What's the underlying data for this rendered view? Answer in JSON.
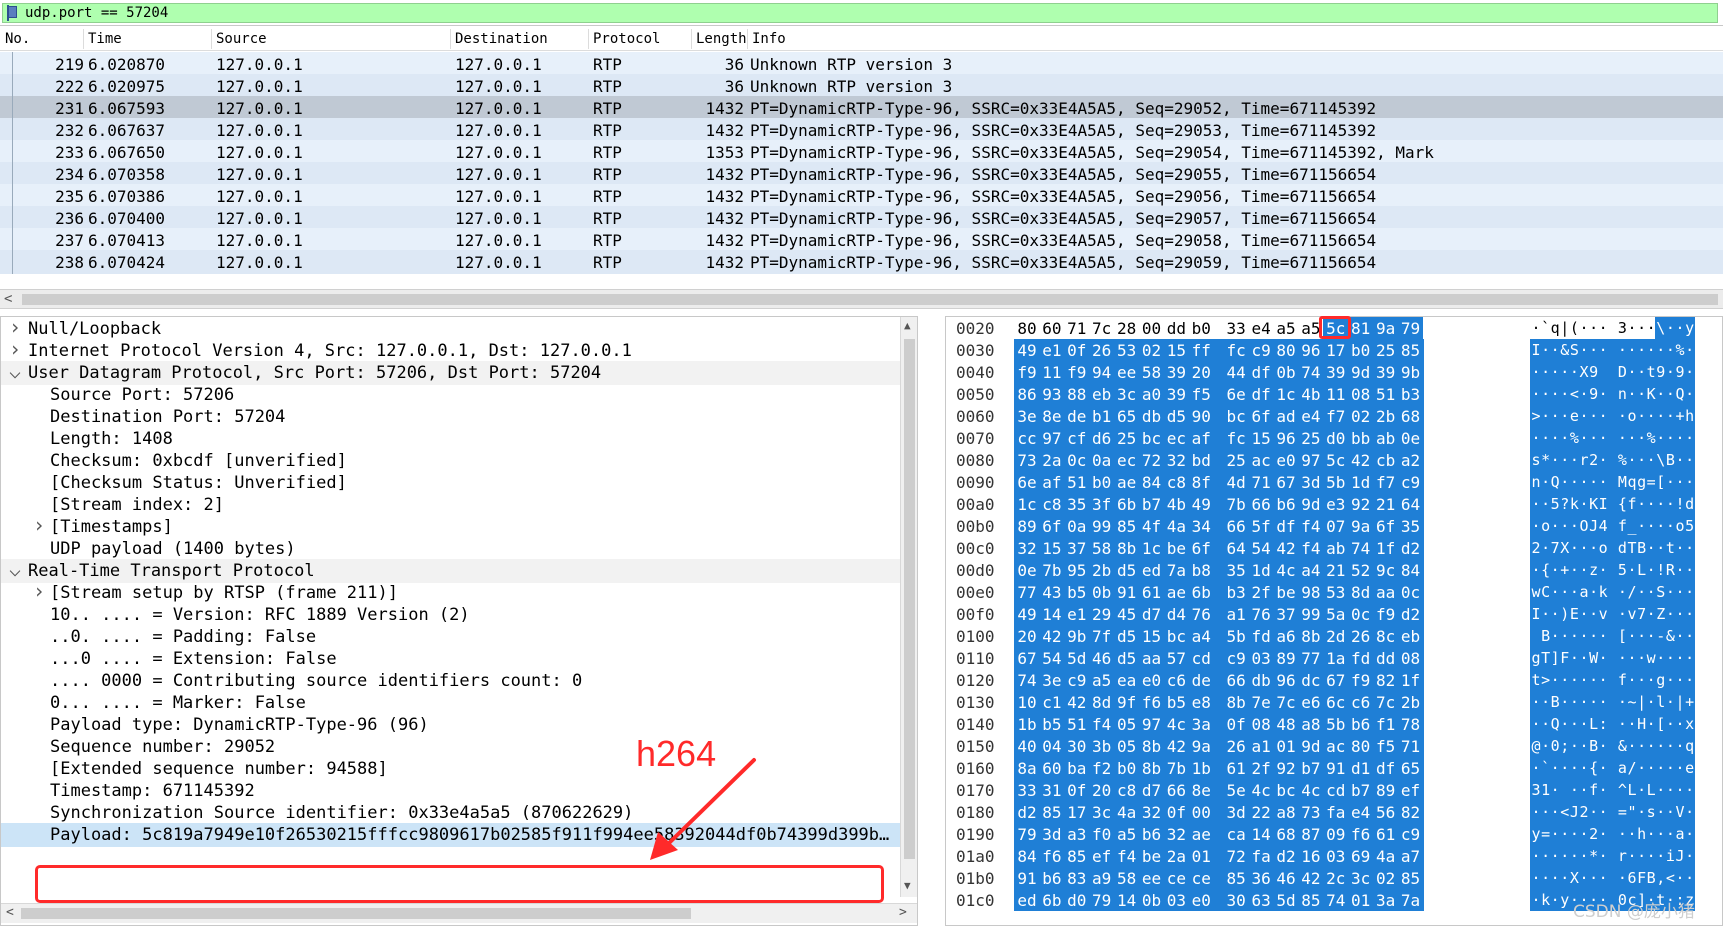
{
  "filter": {
    "text": "udp.port == 57204"
  },
  "packet_list": {
    "columns": [
      "No.",
      "Time",
      "Source",
      "Destination",
      "Protocol",
      "Length",
      "Info"
    ],
    "rows": [
      {
        "no": "219",
        "time": "6.020870",
        "src": "127.0.0.1",
        "dst": "127.0.0.1",
        "proto": "RTP",
        "len": "36",
        "info": "Unknown RTP version 3"
      },
      {
        "no": "222",
        "time": "6.020975",
        "src": "127.0.0.1",
        "dst": "127.0.0.1",
        "proto": "RTP",
        "len": "36",
        "info": "Unknown RTP version 3"
      },
      {
        "no": "231",
        "time": "6.067593",
        "src": "127.0.0.1",
        "dst": "127.0.0.1",
        "proto": "RTP",
        "len": "1432",
        "info": "PT=DynamicRTP-Type-96, SSRC=0x33E4A5A5, Seq=29052, Time=671145392"
      },
      {
        "no": "232",
        "time": "6.067637",
        "src": "127.0.0.1",
        "dst": "127.0.0.1",
        "proto": "RTP",
        "len": "1432",
        "info": "PT=DynamicRTP-Type-96, SSRC=0x33E4A5A5, Seq=29053, Time=671145392"
      },
      {
        "no": "233",
        "time": "6.067650",
        "src": "127.0.0.1",
        "dst": "127.0.0.1",
        "proto": "RTP",
        "len": "1353",
        "info": "PT=DynamicRTP-Type-96, SSRC=0x33E4A5A5, Seq=29054, Time=671145392, Mark"
      },
      {
        "no": "234",
        "time": "6.070358",
        "src": "127.0.0.1",
        "dst": "127.0.0.1",
        "proto": "RTP",
        "len": "1432",
        "info": "PT=DynamicRTP-Type-96, SSRC=0x33E4A5A5, Seq=29055, Time=671156654"
      },
      {
        "no": "235",
        "time": "6.070386",
        "src": "127.0.0.1",
        "dst": "127.0.0.1",
        "proto": "RTP",
        "len": "1432",
        "info": "PT=DynamicRTP-Type-96, SSRC=0x33E4A5A5, Seq=29056, Time=671156654"
      },
      {
        "no": "236",
        "time": "6.070400",
        "src": "127.0.0.1",
        "dst": "127.0.0.1",
        "proto": "RTP",
        "len": "1432",
        "info": "PT=DynamicRTP-Type-96, SSRC=0x33E4A5A5, Seq=29057, Time=671156654"
      },
      {
        "no": "237",
        "time": "6.070413",
        "src": "127.0.0.1",
        "dst": "127.0.0.1",
        "proto": "RTP",
        "len": "1432",
        "info": "PT=DynamicRTP-Type-96, SSRC=0x33E4A5A5, Seq=29058, Time=671156654"
      },
      {
        "no": "238",
        "time": "6.070424",
        "src": "127.0.0.1",
        "dst": "127.0.0.1",
        "proto": "RTP",
        "len": "1432",
        "info": "PT=DynamicRTP-Type-96, SSRC=0x33E4A5A5, Seq=29059, Time=671156654"
      }
    ],
    "selected_index": 2
  },
  "details": [
    {
      "indent": 0,
      "chev": ">",
      "text": "Null/Loopback",
      "section": false
    },
    {
      "indent": 0,
      "chev": ">",
      "text": "Internet Protocol Version 4, Src: 127.0.0.1, Dst: 127.0.0.1",
      "section": false
    },
    {
      "indent": 0,
      "chev": "v",
      "text": "User Datagram Protocol, Src Port: 57206, Dst Port: 57204",
      "section": true
    },
    {
      "indent": 1,
      "chev": "",
      "text": "Source Port: 57206",
      "section": false
    },
    {
      "indent": 1,
      "chev": "",
      "text": "Destination Port: 57204",
      "section": false
    },
    {
      "indent": 1,
      "chev": "",
      "text": "Length: 1408",
      "section": false
    },
    {
      "indent": 1,
      "chev": "",
      "text": "Checksum: 0xbcdf [unverified]",
      "section": false
    },
    {
      "indent": 1,
      "chev": "",
      "text": "[Checksum Status: Unverified]",
      "section": false
    },
    {
      "indent": 1,
      "chev": "",
      "text": "[Stream index: 2]",
      "section": false
    },
    {
      "indent": 1,
      "chev": ">",
      "text": "[Timestamps]",
      "section": false
    },
    {
      "indent": 1,
      "chev": "",
      "text": "UDP payload (1400 bytes)",
      "section": false
    },
    {
      "indent": 0,
      "chev": "v",
      "text": "Real-Time Transport Protocol",
      "section": true
    },
    {
      "indent": 1,
      "chev": ">",
      "text": "[Stream setup by RTSP (frame 211)]",
      "section": false
    },
    {
      "indent": 1,
      "chev": "",
      "text": "10.. .... = Version: RFC 1889 Version (2)",
      "section": false
    },
    {
      "indent": 1,
      "chev": "",
      "text": "..0. .... = Padding: False",
      "section": false
    },
    {
      "indent": 1,
      "chev": "",
      "text": "...0 .... = Extension: False",
      "section": false
    },
    {
      "indent": 1,
      "chev": "",
      "text": ".... 0000 = Contributing source identifiers count: 0",
      "section": false
    },
    {
      "indent": 1,
      "chev": "",
      "text": "0... .... = Marker: False",
      "section": false
    },
    {
      "indent": 1,
      "chev": "",
      "text": "Payload type: DynamicRTP-Type-96 (96)",
      "section": false
    },
    {
      "indent": 1,
      "chev": "",
      "text": "Sequence number: 29052",
      "section": false
    },
    {
      "indent": 1,
      "chev": "",
      "text": "[Extended sequence number: 94588]",
      "section": false
    },
    {
      "indent": 1,
      "chev": "",
      "text": "Timestamp: 671145392",
      "section": false
    },
    {
      "indent": 1,
      "chev": "",
      "text": "Synchronization Source identifier: 0x33e4a5a5 (870622629)",
      "section": false
    },
    {
      "indent": 1,
      "chev": "",
      "text": "Payload: 5c819a7949e10f26530215fffcc9809617b02585f911f994ee58392044df0b74399d399b…",
      "section": false,
      "selected": true
    }
  ],
  "hex": {
    "rows": [
      {
        "off": "0020",
        "bytes": [
          "80",
          "60",
          "71",
          "7c",
          "28",
          "00",
          "dd",
          "b0",
          "33",
          "e4",
          "a5",
          "a5",
          "5c",
          "81",
          "9a",
          "79"
        ],
        "ascii": "·`q|(··· 3···\\··y",
        "hl_start": 12
      },
      {
        "off": "0030",
        "bytes": [
          "49",
          "e1",
          "0f",
          "26",
          "53",
          "02",
          "15",
          "ff",
          "fc",
          "c9",
          "80",
          "96",
          "17",
          "b0",
          "25",
          "85"
        ],
        "ascii": "I··&S··· ······%·",
        "hl_start": 0
      },
      {
        "off": "0040",
        "bytes": [
          "f9",
          "11",
          "f9",
          "94",
          "ee",
          "58",
          "39",
          "20",
          "44",
          "df",
          "0b",
          "74",
          "39",
          "9d",
          "39",
          "9b"
        ],
        "ascii": "·····X9  D··t9·9·",
        "hl_start": 0
      },
      {
        "off": "0050",
        "bytes": [
          "86",
          "93",
          "88",
          "eb",
          "3c",
          "a0",
          "39",
          "f5",
          "6e",
          "df",
          "1c",
          "4b",
          "11",
          "08",
          "51",
          "b3"
        ],
        "ascii": "····<·9· n··K··Q·",
        "hl_start": 0
      },
      {
        "off": "0060",
        "bytes": [
          "3e",
          "8e",
          "de",
          "b1",
          "65",
          "db",
          "d5",
          "90",
          "bc",
          "6f",
          "ad",
          "e4",
          "f7",
          "02",
          "2b",
          "68"
        ],
        "ascii": ">···e··· ·o····+h",
        "hl_start": 0
      },
      {
        "off": "0070",
        "bytes": [
          "cc",
          "97",
          "cf",
          "d6",
          "25",
          "bc",
          "ec",
          "af",
          "fc",
          "15",
          "96",
          "25",
          "d0",
          "bb",
          "ab",
          "0e"
        ],
        "ascii": "····%··· ···%····",
        "hl_start": 0
      },
      {
        "off": "0080",
        "bytes": [
          "73",
          "2a",
          "0c",
          "0a",
          "ec",
          "72",
          "32",
          "bd",
          "25",
          "ac",
          "e0",
          "97",
          "5c",
          "42",
          "cb",
          "a2"
        ],
        "ascii": "s*···r2· %···\\B··",
        "hl_start": 0
      },
      {
        "off": "0090",
        "bytes": [
          "6e",
          "af",
          "51",
          "b0",
          "ae",
          "84",
          "c8",
          "8f",
          "4d",
          "71",
          "67",
          "3d",
          "5b",
          "1d",
          "f7",
          "c9"
        ],
        "ascii": "n·Q····· Mqg=[···",
        "hl_start": 0
      },
      {
        "off": "00a0",
        "bytes": [
          "1c",
          "c8",
          "35",
          "3f",
          "6b",
          "b7",
          "4b",
          "49",
          "7b",
          "66",
          "b6",
          "9d",
          "e3",
          "92",
          "21",
          "64"
        ],
        "ascii": "··5?k·KI {f····!d",
        "hl_start": 0
      },
      {
        "off": "00b0",
        "bytes": [
          "89",
          "6f",
          "0a",
          "99",
          "85",
          "4f",
          "4a",
          "34",
          "66",
          "5f",
          "df",
          "f4",
          "07",
          "9a",
          "6f",
          "35"
        ],
        "ascii": "·o···OJ4 f_····o5",
        "hl_start": 0
      },
      {
        "off": "00c0",
        "bytes": [
          "32",
          "15",
          "37",
          "58",
          "8b",
          "1c",
          "be",
          "6f",
          "64",
          "54",
          "42",
          "f4",
          "ab",
          "74",
          "1f",
          "d2"
        ],
        "ascii": "2·7X···o dTB··t··",
        "hl_start": 0
      },
      {
        "off": "00d0",
        "bytes": [
          "0e",
          "7b",
          "95",
          "2b",
          "d5",
          "ed",
          "7a",
          "b8",
          "35",
          "1d",
          "4c",
          "a4",
          "21",
          "52",
          "9c",
          "84"
        ],
        "ascii": "·{·+··z· 5·L·!R··",
        "hl_start": 0
      },
      {
        "off": "00e0",
        "bytes": [
          "77",
          "43",
          "b5",
          "0b",
          "91",
          "61",
          "ae",
          "6b",
          "b3",
          "2f",
          "be",
          "98",
          "53",
          "8d",
          "aa",
          "0c"
        ],
        "ascii": "wC···a·k ·/··S···",
        "hl_start": 0
      },
      {
        "off": "00f0",
        "bytes": [
          "49",
          "14",
          "e1",
          "29",
          "45",
          "d7",
          "d4",
          "76",
          "a1",
          "76",
          "37",
          "99",
          "5a",
          "0c",
          "f9",
          "d2"
        ],
        "ascii": "I··)E··v ·v7·Z···",
        "hl_start": 0
      },
      {
        "off": "0100",
        "bytes": [
          "20",
          "42",
          "9b",
          "7f",
          "d5",
          "15",
          "bc",
          "a4",
          "5b",
          "fd",
          "a6",
          "8b",
          "2d",
          "26",
          "8c",
          "eb"
        ],
        "ascii": " B······ [···-&··",
        "hl_start": 0
      },
      {
        "off": "0110",
        "bytes": [
          "67",
          "54",
          "5d",
          "46",
          "d5",
          "aa",
          "57",
          "cd",
          "c9",
          "03",
          "89",
          "77",
          "1a",
          "fd",
          "dd",
          "08"
        ],
        "ascii": "gT]F··W· ···w····",
        "hl_start": 0
      },
      {
        "off": "0120",
        "bytes": [
          "74",
          "3e",
          "c9",
          "a5",
          "ea",
          "e0",
          "c6",
          "de",
          "66",
          "db",
          "96",
          "dc",
          "67",
          "f9",
          "82",
          "1f"
        ],
        "ascii": "t>······ f···g···",
        "hl_start": 0
      },
      {
        "off": "0130",
        "bytes": [
          "10",
          "c1",
          "42",
          "8d",
          "9f",
          "f6",
          "b5",
          "e8",
          "8b",
          "7e",
          "7c",
          "e6",
          "6c",
          "c6",
          "7c",
          "2b"
        ],
        "ascii": "··B····· ·~|·l·|+",
        "hl_start": 0
      },
      {
        "off": "0140",
        "bytes": [
          "1b",
          "b5",
          "51",
          "f4",
          "05",
          "97",
          "4c",
          "3a",
          "0f",
          "08",
          "48",
          "a8",
          "5b",
          "b6",
          "f1",
          "78"
        ],
        "ascii": "··Q···L: ··H·[··x",
        "hl_start": 0
      },
      {
        "off": "0150",
        "bytes": [
          "40",
          "04",
          "30",
          "3b",
          "05",
          "8b",
          "42",
          "9a",
          "26",
          "a1",
          "01",
          "9d",
          "ac",
          "80",
          "f5",
          "71"
        ],
        "ascii": "@·0;··B· &······q",
        "hl_start": 0
      },
      {
        "off": "0160",
        "bytes": [
          "8a",
          "60",
          "ba",
          "f2",
          "b0",
          "8b",
          "7b",
          "1b",
          "61",
          "2f",
          "92",
          "b7",
          "91",
          "d1",
          "df",
          "65"
        ],
        "ascii": "·`····{· a/·····e",
        "hl_start": 0
      },
      {
        "off": "0170",
        "bytes": [
          "33",
          "31",
          "0f",
          "20",
          "c8",
          "d7",
          "66",
          "8e",
          "5e",
          "4c",
          "bc",
          "4c",
          "cd",
          "b7",
          "89",
          "ef"
        ],
        "ascii": "31· ··f· ^L·L····",
        "hl_start": 0
      },
      {
        "off": "0180",
        "bytes": [
          "d2",
          "85",
          "17",
          "3c",
          "4a",
          "32",
          "0f",
          "00",
          "3d",
          "22",
          "a8",
          "73",
          "fa",
          "e4",
          "56",
          "82"
        ],
        "ascii": "···<J2·· =\"·s··V·",
        "hl_start": 0
      },
      {
        "off": "0190",
        "bytes": [
          "79",
          "3d",
          "a3",
          "f0",
          "a5",
          "b6",
          "32",
          "ae",
          "ca",
          "14",
          "68",
          "87",
          "09",
          "f6",
          "61",
          "c9"
        ],
        "ascii": "y=····2· ··h···a·",
        "hl_start": 0
      },
      {
        "off": "01a0",
        "bytes": [
          "84",
          "f6",
          "85",
          "ef",
          "f4",
          "be",
          "2a",
          "01",
          "72",
          "fa",
          "d2",
          "16",
          "03",
          "69",
          "4a",
          "a7"
        ],
        "ascii": "······*· r····iJ·",
        "hl_start": 0
      },
      {
        "off": "01b0",
        "bytes": [
          "91",
          "b6",
          "83",
          "a9",
          "58",
          "ee",
          "ce",
          "ce",
          "85",
          "36",
          "46",
          "42",
          "2c",
          "3c",
          "02",
          "85"
        ],
        "ascii": "····X··· ·6FB,<··",
        "hl_start": 0
      },
      {
        "off": "01c0",
        "bytes": [
          "ed",
          "6b",
          "d0",
          "79",
          "14",
          "0b",
          "03",
          "e0",
          "30",
          "63",
          "5d",
          "85",
          "74",
          "01",
          "3a",
          "7a"
        ],
        "ascii": "·k·y···· 0c]·t·:z",
        "hl_start": 0
      }
    ]
  },
  "annotation": {
    "label": "h264"
  },
  "watermark": "CSDN @庞小猪",
  "colors": {
    "filter_bg": "#afffaf",
    "row_bg": "#e7f0fa",
    "row_selected": "#c0c9d4",
    "hex_highlight": "#1f7fd6",
    "annotation": "#ff2a2a"
  }
}
